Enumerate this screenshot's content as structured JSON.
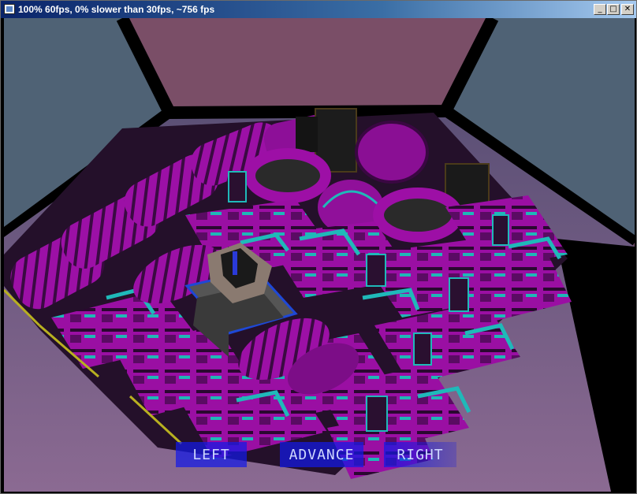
{
  "window": {
    "title": "100% 60fps, 0% slower than 30fps, ~756 fps",
    "minimize_glyph": "_",
    "maximize_glyph": "□",
    "close_glyph": "✕",
    "icon": "app-window-icon"
  },
  "hud": {
    "left_label": "LEFT",
    "advance_label": "ADVANCE",
    "right_label": "RIGHT",
    "button_color": "#1a1ae6"
  },
  "scene": {
    "walls_color": "#4f6275",
    "back_wall_color": "#7a4f68",
    "floor_color": "#68557a",
    "block_primary": "#a012a8",
    "block_accent": "#1fb9b9"
  }
}
